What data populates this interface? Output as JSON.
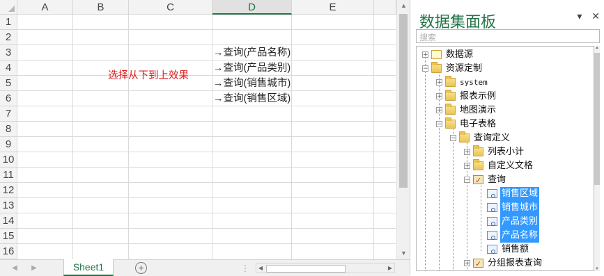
{
  "spreadsheet": {
    "columns": [
      "A",
      "B",
      "C",
      "D",
      "E"
    ],
    "active_column": "D",
    "rows": [
      "1",
      "2",
      "3",
      "4",
      "5",
      "6",
      "7",
      "8",
      "9",
      "10",
      "11",
      "12",
      "13",
      "14",
      "15",
      "16"
    ],
    "cells": {
      "D3": "→查询(产品名称)",
      "D4": "→查询(产品类别)",
      "D5": "→查询(销售城市)",
      "D6": "→查询(销售区域)",
      "B4": "选择从下到上效果"
    },
    "sheet_tab": "Sheet1",
    "add_sheet_icon": "plus-circle-icon"
  },
  "panel": {
    "title": "数据集面板",
    "dropdown_icon": "▾",
    "close_icon": "✕",
    "search_placeholder": "搜索",
    "tree": [
      {
        "label": "数据源",
        "icon": "datasource-icon",
        "expander": "+"
      },
      {
        "label": "资源定制",
        "icon": "folder-icon",
        "expander": "−"
      },
      {
        "label": "system",
        "icon": "folder-icon",
        "expander": "+"
      },
      {
        "label": "报表示例",
        "icon": "folder-icon",
        "expander": "+"
      },
      {
        "label": "地图演示",
        "icon": "folder-icon",
        "expander": "+"
      },
      {
        "label": "电子表格",
        "icon": "folder-icon",
        "expander": "−"
      },
      {
        "label": "查询定义",
        "icon": "folder-icon",
        "expander": "−"
      },
      {
        "label": "列表小计",
        "icon": "folder-icon",
        "expander": "+"
      },
      {
        "label": "自定义文格",
        "icon": "folder-icon",
        "expander": "+"
      },
      {
        "label": "查询",
        "icon": "query-icon",
        "expander": "−"
      },
      {
        "label": "销售区域",
        "icon": "field-icon",
        "selected": true
      },
      {
        "label": "销售城市",
        "icon": "field-icon",
        "selected": true
      },
      {
        "label": "产品类别",
        "icon": "field-icon",
        "selected": true
      },
      {
        "label": "产品名称",
        "icon": "field-icon",
        "selected": true
      },
      {
        "label": "销售额",
        "icon": "field-icon",
        "selected": false
      },
      {
        "label": "分组报表查询",
        "icon": "query-icon",
        "expander": "+"
      }
    ]
  },
  "colors": {
    "excel_green": "#217346",
    "selection_blue": "#3399ff",
    "annotation_red": "#e01b1b"
  }
}
